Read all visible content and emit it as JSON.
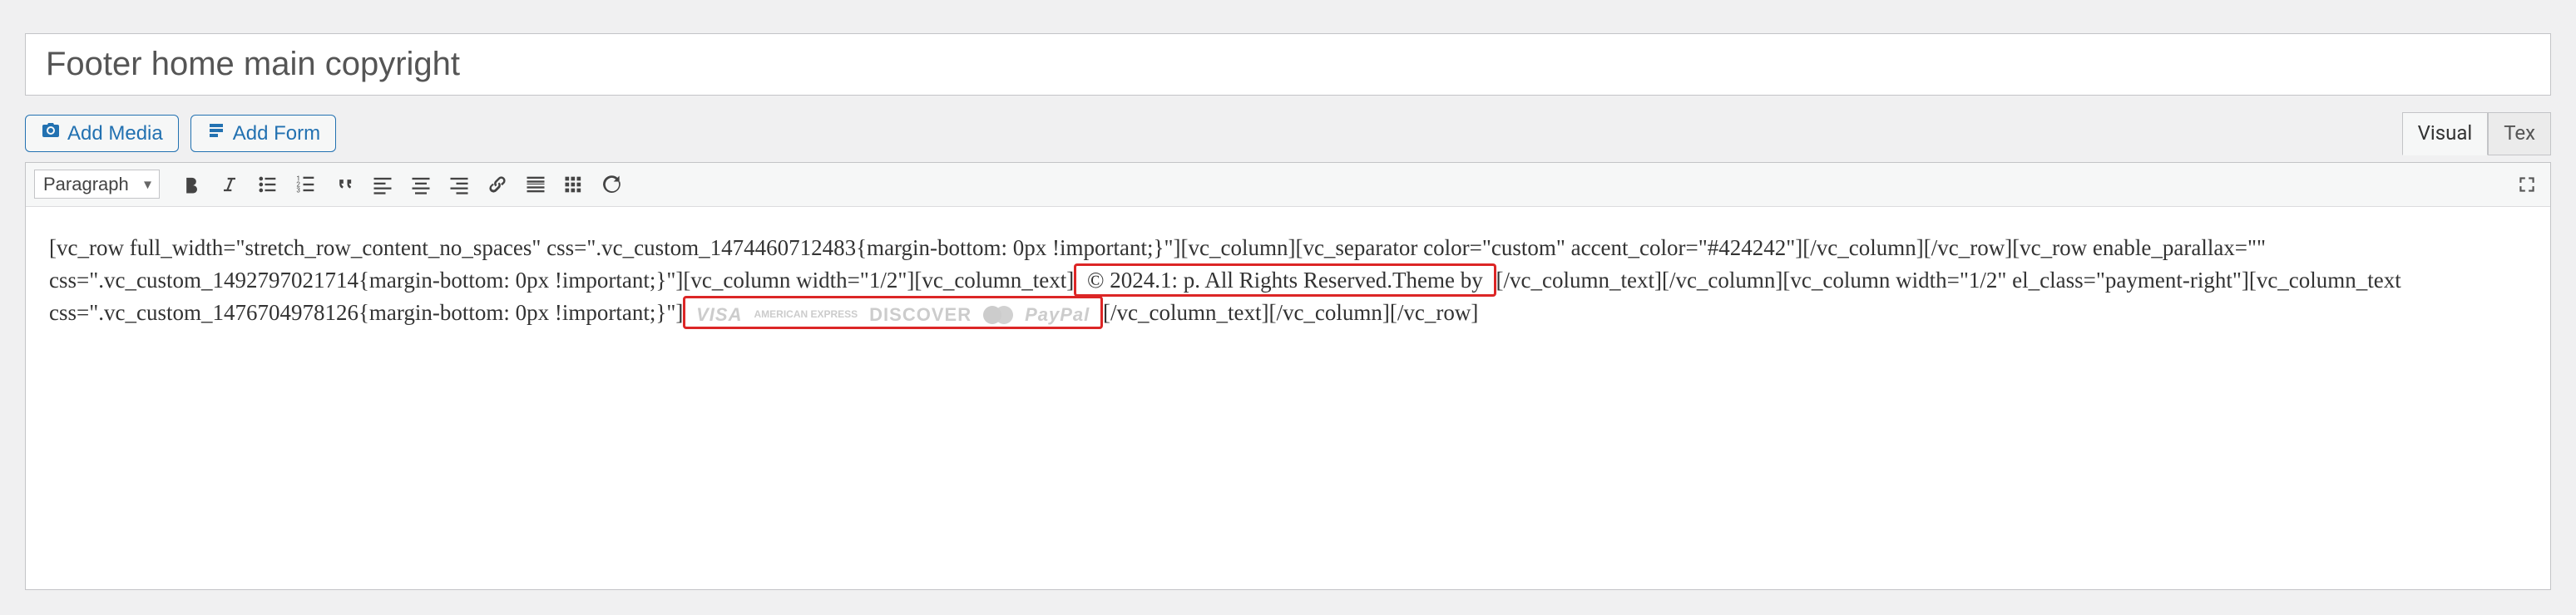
{
  "post": {
    "title": "Footer home main copyright"
  },
  "buttons": {
    "add_media": "Add Media",
    "add_form": "Add Form"
  },
  "tabs": {
    "visual": "Visual",
    "text": "Tex"
  },
  "toolbar": {
    "format": "Paragraph"
  },
  "content": {
    "seg1": "[vc_row full_width=\"stretch_row_content_no_spaces\" css=\".vc_custom_1474460712483{margin-bottom: 0px !important;}\"][vc_column][vc_separator color=\"custom\" accent_color=\"#424242\"][/vc_column][/vc_row][vc_row enable_parallax=\"\" css=\".vc_custom_1492797021714{margin-bottom: 0px !important;}\"][vc_column width=\"1/2\"][vc_column_text]",
    "copyright_box": " © 2024.1:             p. All Rights Reserved.Theme by ",
    "seg2": "[/vc_column_text][/vc_column][vc_column width=\"1/2\" el_class=\"payment-right\"][vc_column_text css=\".vc_custom_1476704978126{margin-bottom: 0px !important;}\"]",
    "logos": {
      "visa": "VISA",
      "amex": "AMERICAN EXPRESS",
      "discover": "DISCOVER",
      "mastercard": "mastercard",
      "paypal": "PayPal"
    },
    "seg3": "[/vc_column_text][/vc_column][/vc_row]"
  }
}
